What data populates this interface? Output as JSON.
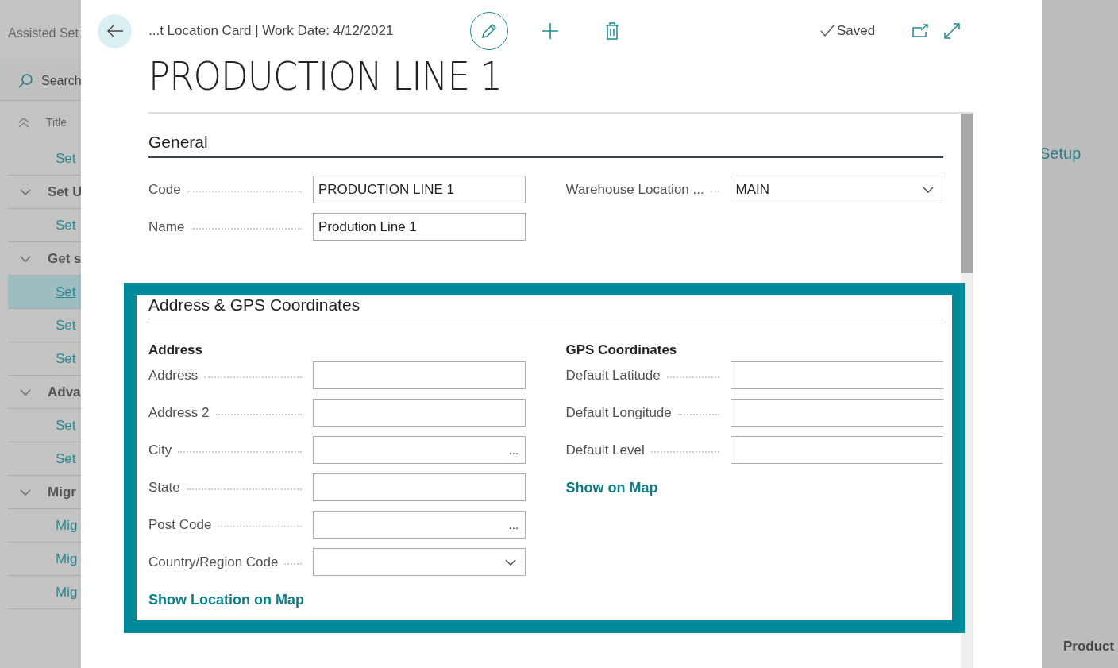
{
  "background_page": {
    "title": "Assisted Set",
    "search": {
      "placeholder": "Search"
    },
    "column_header": "Title",
    "rows": [
      {
        "kind": "item",
        "label": "Set",
        "selected": false
      },
      {
        "kind": "group",
        "label": "Set U",
        "expanded": true
      },
      {
        "kind": "item",
        "label": "Set",
        "selected": false
      },
      {
        "kind": "group",
        "label": "Get s",
        "expanded": true
      },
      {
        "kind": "item",
        "label": "Set",
        "selected": true
      },
      {
        "kind": "item",
        "label": "Set",
        "selected": false
      },
      {
        "kind": "item",
        "label": "Set",
        "selected": false
      },
      {
        "kind": "group",
        "label": "Adva",
        "expanded": true
      },
      {
        "kind": "item",
        "label": "Set",
        "selected": false
      },
      {
        "kind": "item",
        "label": "Set",
        "selected": false
      },
      {
        "kind": "group",
        "label": "Migr",
        "expanded": true
      },
      {
        "kind": "item",
        "label": "Mig",
        "selected": false
      },
      {
        "kind": "item",
        "label": "Mig",
        "selected": false
      },
      {
        "kind": "item",
        "label": "Mig",
        "selected": false
      }
    ],
    "right_link": "Setup",
    "right_column_header": "Product"
  },
  "card": {
    "breadcrumb": "...t Location Card | Work Date: 4/12/2021",
    "status": "Saved",
    "title": "PRODUCTION LINE 1",
    "sections": [
      {
        "title": "General",
        "highlighted": false,
        "columns": [
          {
            "fields": [
              {
                "label": "Code",
                "value": "PRODUCTION LINE 1",
                "kind": "text"
              },
              {
                "label": "Name",
                "value": "Prodution Line 1",
                "kind": "text"
              }
            ]
          },
          {
            "fields": [
              {
                "label": "Warehouse Location ...",
                "value": "MAIN",
                "kind": "dropdown"
              }
            ]
          }
        ]
      },
      {
        "title": "Address & GPS Coordinates",
        "highlighted": true,
        "columns": [
          {
            "subtitle": "Address",
            "fields": [
              {
                "label": "Address",
                "kind": "text"
              },
              {
                "label": "Address 2",
                "kind": "text"
              },
              {
                "label": "City",
                "kind": "lookup",
                "button": "..."
              },
              {
                "label": "State",
                "kind": "text"
              },
              {
                "label": "Post Code",
                "kind": "lookup",
                "button": "..."
              },
              {
                "label": "Country/Region Code",
                "kind": "dropdown"
              }
            ],
            "link": "Show Location on Map"
          },
          {
            "subtitle": "GPS Coordinates",
            "fields": [
              {
                "label": "Default Latitude",
                "kind": "text"
              },
              {
                "label": "Default Longitude",
                "kind": "text"
              },
              {
                "label": "Default Level",
                "kind": "text"
              }
            ],
            "link": "Show on Map"
          }
        ]
      }
    ]
  }
}
